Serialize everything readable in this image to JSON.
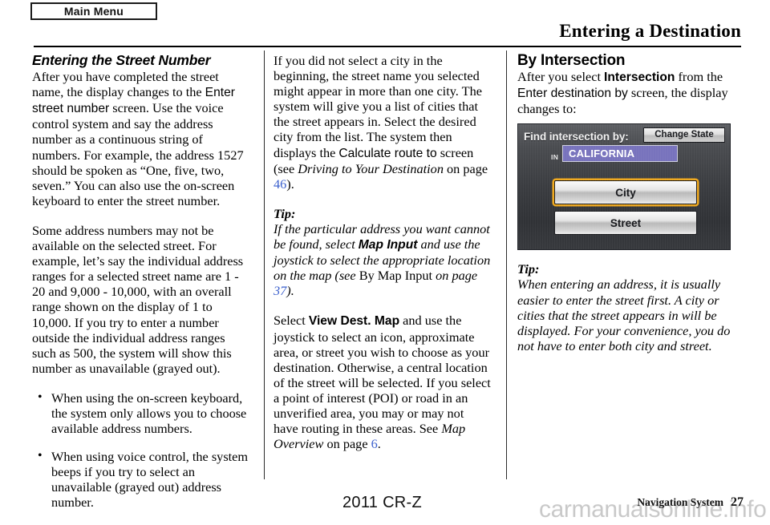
{
  "header": {
    "main_menu_tab": "Main Menu",
    "page_title": "Entering a Destination"
  },
  "column_1": {
    "heading": "Entering the Street Number",
    "para_1": {
      "t1": "After you have completed the street name, the display changes to the ",
      "ui1": "Enter street number",
      "t2": " screen. Use the voice control system and say the address number as a continuous string of numbers. For example, the address 1527 should be spoken as “One, five, two, seven.” You can also use the on-screen keyboard to enter the street number."
    },
    "para_2": "Some address numbers may not be available on the selected street. For example, let’s say the individual address ranges for a selected street name are 1 - 20 and 9,000 - 10,000, with an overall range shown on the display of 1 to 10,000. If you try to enter a number outside the individual address ranges such as 500, the system will show this number as unavailable (grayed out).",
    "bullets": [
      "When using the on-screen keyboard, the system only allows you to choose available address numbers.",
      "When using voice control, the system beeps if you try to select an unavailable (grayed out) address number."
    ]
  },
  "column_2": {
    "para_1": {
      "t1": "If you did not select a city in the beginning, the street name you selected might appear in more than one city. The system will give you a list of cities that the street appears in. Select the desired city from the list. The system then displays the ",
      "ui1": "Calculate route to",
      "t2": " screen (see ",
      "ital1": "Driving to Your Destination",
      "t3": " on page ",
      "page": "46",
      "t4": ")."
    },
    "tip_label": "Tip:",
    "tip": {
      "t1": "If the particular address you want cannot be found, select ",
      "ui1": "Map Input",
      "t2": " and use the joystick to select the appropriate location on the map (see ",
      "plain1": "By Map Input",
      "t3": " on page ",
      "page": "37",
      "t4": ")."
    },
    "para_2": {
      "t1": "Select ",
      "ui1": "View Dest. Map",
      "t2": " and use the joystick to select an icon, approximate area, or street you wish to choose as your destination. Otherwise, a central location of the street will be selected. If you select a point of interest (POI) or road in an unverified area, you may or may not have routing in these areas. See ",
      "ital1": "Map Overview",
      "t3": " on page ",
      "page": "6",
      "t4": "."
    }
  },
  "column_3": {
    "heading": "By Intersection",
    "para_1": {
      "t1": "After you select ",
      "ui1": "Intersection",
      "t2": " from the ",
      "ui2": "Enter destination by",
      "t3": " screen, the display changes to:"
    },
    "nav_screen": {
      "title": "Find intersection by:",
      "change_state_button": "Change State",
      "in_label": "IN",
      "state_value": "CALIFORNIA",
      "city_button": "City",
      "street_button": "Street",
      "highlight_color": "#f0a91e",
      "state_field_color": "#7873bd"
    },
    "tip_label": "Tip:",
    "tip": "When entering an address, it is usually easier to enter the street first. A city or cities that the street appears in will be displayed. For your convenience, you do not have to enter both city and street."
  },
  "footer": {
    "model": "2011 CR-Z",
    "section": "Navigation System",
    "page_number": "27",
    "watermark": "carmanualsonline.info"
  }
}
